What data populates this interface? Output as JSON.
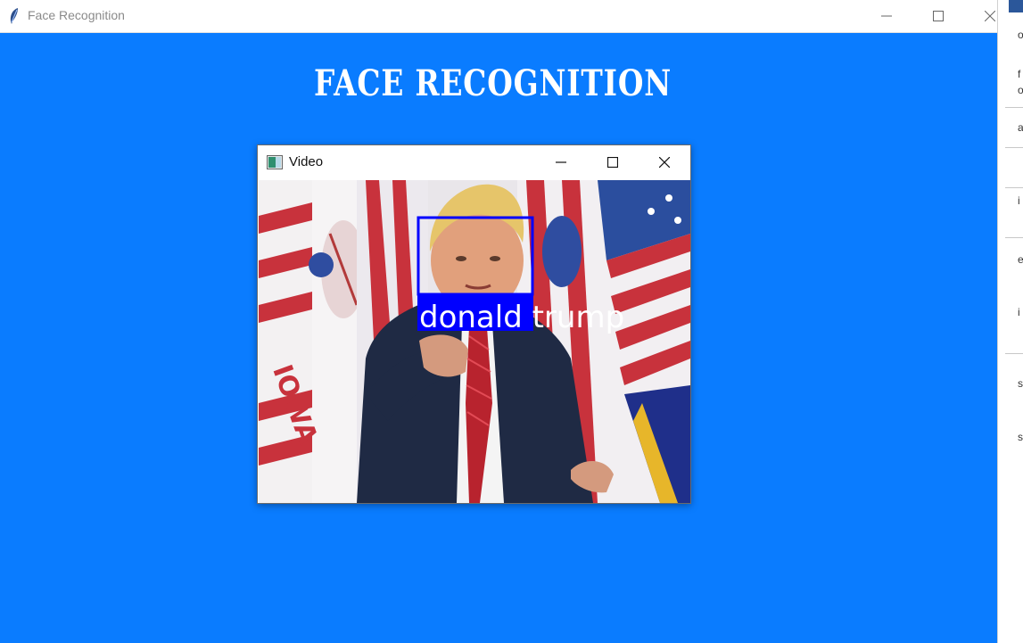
{
  "main_window": {
    "title": "Face Recognition",
    "heading": "FACE RECOGNITION",
    "background_color": "#0a7cff",
    "controls": [
      "minimize-icon",
      "maximize-icon",
      "close-icon"
    ]
  },
  "video_window": {
    "title": "Video",
    "controls": [
      "minimize-icon",
      "maximize-icon",
      "close-icon"
    ],
    "detection": {
      "label": "donald trump",
      "box_color": "#0000ff",
      "label_color": "#ffffff"
    },
    "flag_text": "IOWA"
  },
  "background_window": {
    "edge_chars": [
      "o",
      "f",
      "o",
      "a",
      "i",
      "e",
      "i",
      "s",
      "s"
    ]
  }
}
